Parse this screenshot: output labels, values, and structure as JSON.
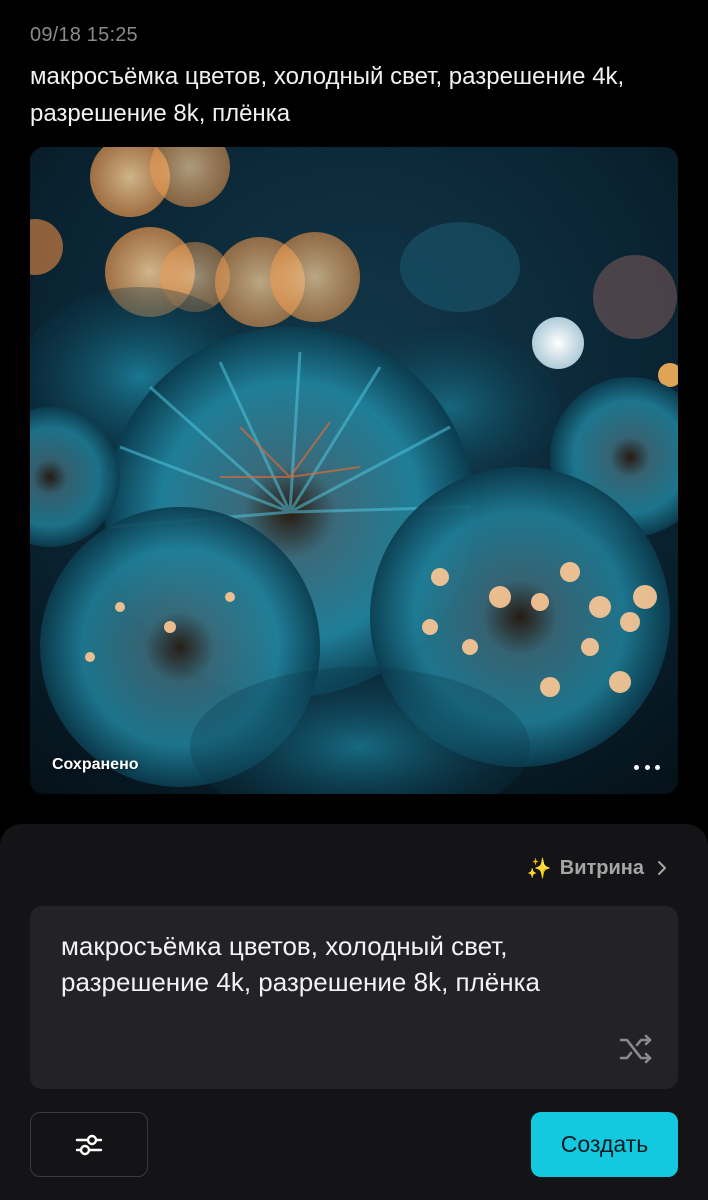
{
  "header": {
    "timestamp": "09/18 15:25",
    "prompt": "макросъёмка цветов, холодный свет, разрешение 4k, разрешение 8k, плёнка"
  },
  "image_card": {
    "status_label": "Сохранено",
    "more_icon": "more-horizontal-icon"
  },
  "panel": {
    "showcase_label": "Витрина",
    "showcase_icon": "sparkle-icon",
    "prompt_value": "макросъёмка цветов, холодный свет, разрешение 4k, разрешение 8k, плёнка",
    "shuffle_icon": "shuffle-icon",
    "settings_icon": "sliders-icon",
    "create_label": "Создать"
  },
  "colors": {
    "accent": "#13c9e0",
    "background": "#000000",
    "panel": "#141416",
    "input": "#232327"
  }
}
